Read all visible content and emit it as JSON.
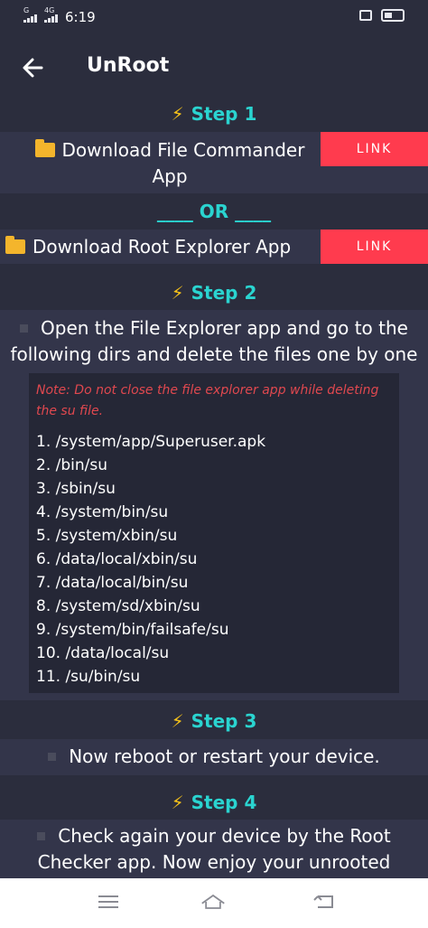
{
  "status": {
    "time": "6:19",
    "sim1": "G",
    "sim2": "4G"
  },
  "appbar": {
    "title": "UnRoot"
  },
  "steps": [
    {
      "label": "Step 1"
    },
    {
      "label": "Step 2"
    },
    {
      "label": "Step 3"
    },
    {
      "label": "Step 4"
    }
  ],
  "step1": {
    "item1_line1": "Download File Commander",
    "item1_line2": "App",
    "link1": "LINK",
    "or_text": "____ OR ____",
    "item2": "Download Root Explorer App",
    "link2": "LINK"
  },
  "step2": {
    "line1": "Open the File Explorer app and go to the",
    "line2": "following dirs and delete the files one by one",
    "note_line1": "Note: Do not close the file explorer app while deleting",
    "note_line2": "the su file.",
    "dirs": [
      "1.  /system/app/Superuser.apk",
      "2.  /bin/su",
      "3.  /sbin/su",
      "4.  /system/bin/su",
      "5.  /system/xbin/su",
      "6.  /data/local/xbin/su",
      "7.  /data/local/bin/su",
      "8.  /system/sd/xbin/su",
      "9.  /system/bin/failsafe/su",
      "10.  /data/local/su",
      "11.  /su/bin/su"
    ]
  },
  "step3": {
    "text": "Now reboot or restart your device."
  },
  "step4": {
    "line1": "Check again your device by the Root",
    "line2": "Checker app. Now enjoy your unrooted"
  },
  "colors": {
    "background": "#2b2d3d",
    "card": "#33354a",
    "accent": "#2ad4d0",
    "link_button": "#ff3b4e",
    "note_text": "#e0484f"
  },
  "icons": [
    "back-arrow-icon",
    "lightning-icon",
    "folder-icon",
    "menu-icon",
    "home-icon",
    "return-icon"
  ]
}
